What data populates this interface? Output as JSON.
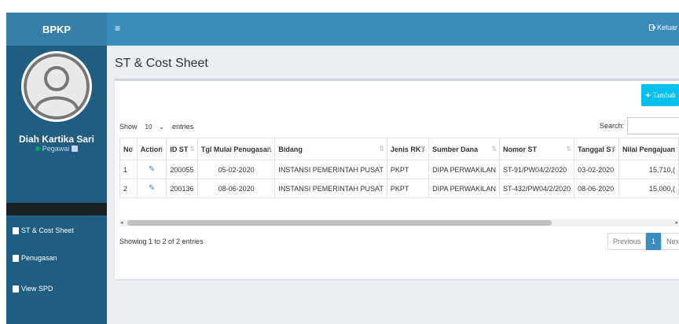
{
  "brand": "BPKP",
  "topbar": {
    "menu_icon": "≡",
    "logout_label": "Keluar"
  },
  "user": {
    "name": "Diah Kartika Sari",
    "role": "Pegawai"
  },
  "sidebar": {
    "items": [
      {
        "label": "ST & Cost Sheet"
      },
      {
        "label": "Penugasan"
      },
      {
        "label": "View SPD"
      }
    ]
  },
  "page": {
    "title": "ST & Cost Sheet"
  },
  "toolbar": {
    "add_label": "Tambah"
  },
  "table_controls": {
    "show_label": "Show",
    "entries_value": "10",
    "entries_label": "entries",
    "search_label": "Search:",
    "search_value": ""
  },
  "table": {
    "headers": [
      "No",
      "Action",
      "ID ST",
      "Tgl Mulai Penugasan",
      "Bidang",
      "Jenis RKT",
      "Sumber Dana",
      "Nomor ST",
      "Tanggal ST",
      "Nilai Pengajuan"
    ],
    "rows": [
      [
        "1",
        "",
        "200055",
        "05-02-2020",
        "INSTANSI PEMERINTAH PUSAT",
        "PKPT",
        "DIPA PERWAKILAN",
        "ST-91/PW04/2/2020",
        "03-02-2020",
        "15,710,("
      ],
      [
        "2",
        "",
        "200136",
        "08-06-2020",
        "INSTANSI PEMERINTAH PUSAT",
        "PKPT",
        "DIPA PERWAKILAN",
        "ST-432/PW04/2/2020",
        "08-06-2020",
        "15,000,("
      ]
    ]
  },
  "footer": {
    "info": "Showing 1 to 2 of 2 entries",
    "prev_label": "Previous",
    "page_label": "1",
    "next_label": "Next"
  },
  "colors": {
    "header": "#3c8dbc",
    "brand": "#367fa9",
    "sidebar": "#1f5d82",
    "add_button": "#00c0ef"
  },
  "icons": {
    "menu": "hamburger-icon",
    "logout": "logout-icon",
    "edit": "edit-icon",
    "sidebar_item": "book-icon",
    "add": "plus-icon"
  }
}
